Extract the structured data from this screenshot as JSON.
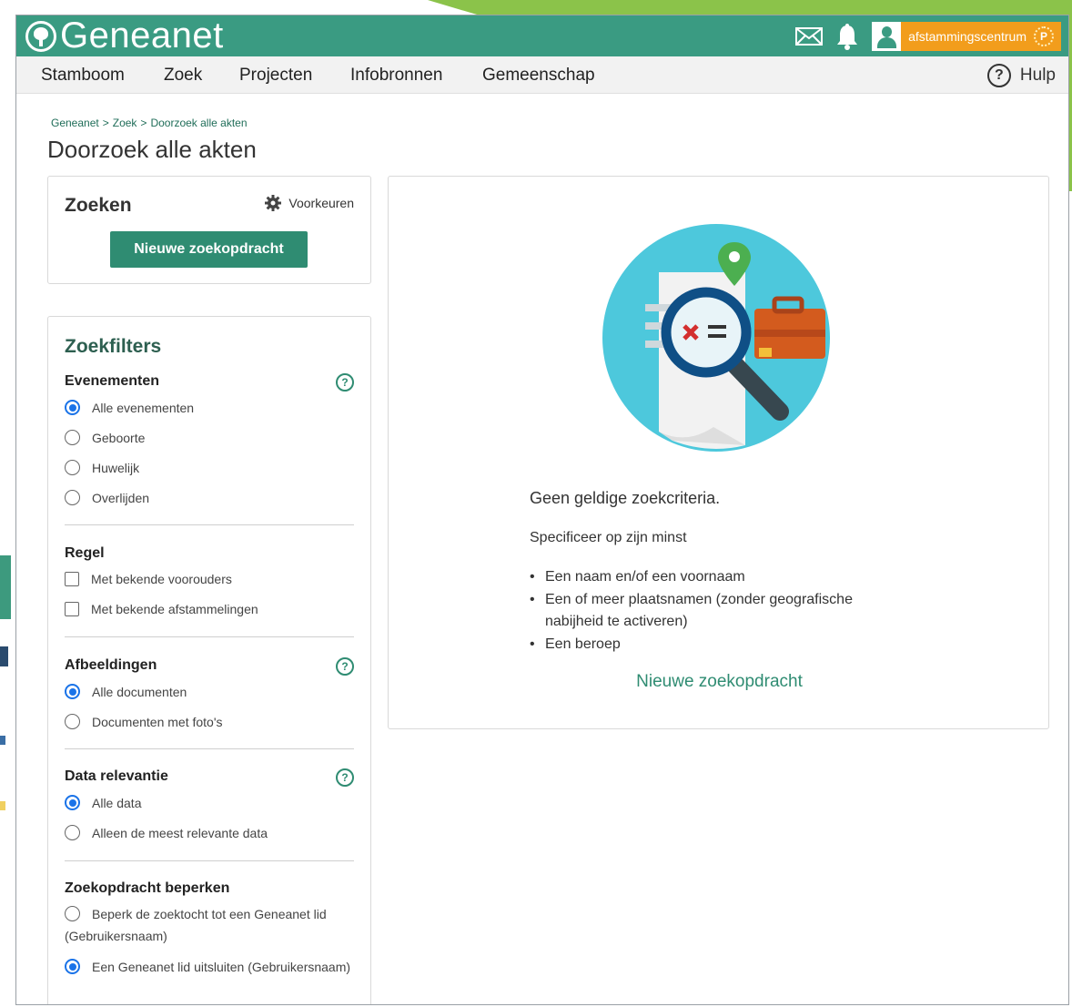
{
  "brand": {
    "name": "Geneanet"
  },
  "user": {
    "name": "afstammingscentrum",
    "badge": "P"
  },
  "nav": {
    "items": [
      "Stamboom",
      "Zoek",
      "Projecten",
      "Infobronnen",
      "Gemeenschap"
    ],
    "help_label": "Hulp",
    "help_symbol": "?"
  },
  "breadcrumb": [
    "Geneanet",
    ">",
    "Zoek",
    ">",
    "Doorzoek alle akten"
  ],
  "page_title": "Doorzoek alle akten",
  "search_panel": {
    "title": "Zoeken",
    "preferences_label": "Voorkeuren",
    "new_search_button": "Nieuwe zoekopdracht"
  },
  "filters": {
    "title": "Zoekfilters",
    "help_symbol": "?",
    "events": {
      "title": "Evenementen",
      "options": [
        "Alle evenementen",
        "Geboorte",
        "Huwelijk",
        "Overlijden"
      ],
      "selected": "Alle evenementen"
    },
    "rule": {
      "title": "Regel",
      "options": [
        "Met bekende voorouders",
        "Met bekende afstammelingen"
      ]
    },
    "images": {
      "title": "Afbeeldingen",
      "options": [
        "Alle documenten",
        "Documenten met foto's"
      ],
      "selected": "Alle documenten"
    },
    "relevance": {
      "title": "Data relevantie",
      "options": [
        "Alle data",
        "Alleen de meest relevante data"
      ],
      "selected": "Alle data"
    },
    "restrict": {
      "title": "Zoekopdracht beperken",
      "options": [
        "Beperk de zoektocht tot een Geneanet lid (Gebruikersnaam)",
        "Een Geneanet lid uitsluiten (Gebruikersnaam)"
      ],
      "selected": "Een Geneanet lid uitsluiten (Gebruikersnaam)"
    }
  },
  "results": {
    "title": "Geen geldige zoekcriteria.",
    "subtitle": "Specificeer op zijn minst",
    "criteria": [
      "Een naam en/of een voornaam",
      "Een of meer plaatsnamen (zonder geografische nabijheid te activeren)",
      "Een beroep"
    ],
    "new_search_link": "Nieuwe zoekopdracht"
  },
  "colors": {
    "brand_green": "#3a9b82",
    "button_green": "#2f8c72",
    "user_orange": "#f29d1c",
    "radio_blue": "#1a73e8"
  },
  "icons": [
    "geneanet-logo-icon",
    "mail-icon",
    "bell-icon",
    "user-avatar-icon",
    "premium-badge-icon",
    "help-icon",
    "gear-icon",
    "search-illustration"
  ]
}
